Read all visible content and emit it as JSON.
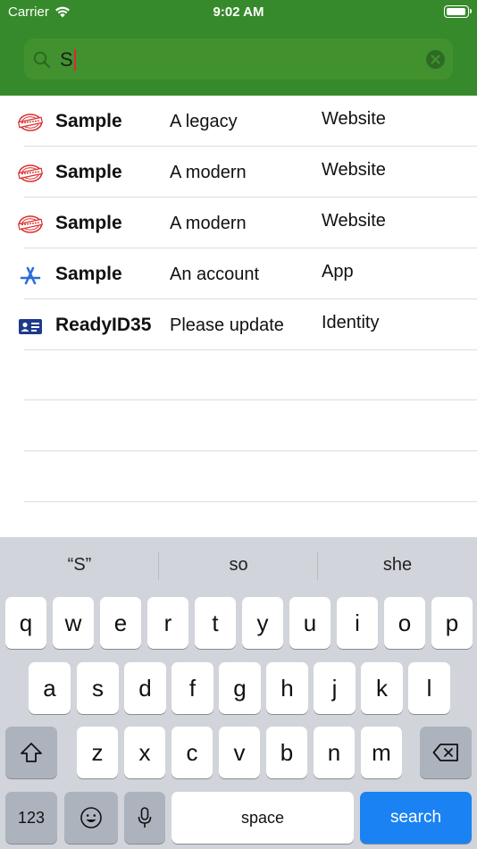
{
  "status_bar": {
    "carrier": "Carrier",
    "time": "9:02 AM"
  },
  "search": {
    "query": "S"
  },
  "results": [
    {
      "icon": "stamp-icon",
      "title": "Sample",
      "subtitle": "A legacy",
      "type": "Website"
    },
    {
      "icon": "stamp-icon",
      "title": "Sample",
      "subtitle": "A modern",
      "type": "Website"
    },
    {
      "icon": "stamp-icon",
      "title": "Sample",
      "subtitle": "A modern",
      "type": "Website"
    },
    {
      "icon": "app-store-icon",
      "title": "Sample",
      "subtitle": "An account",
      "type": "App"
    },
    {
      "icon": "id-card-icon",
      "title": "ReadyID35",
      "subtitle": "Please update",
      "type": "Identity"
    }
  ],
  "keyboard": {
    "suggestions": [
      "“S”",
      "so",
      "she"
    ],
    "row1": [
      "q",
      "w",
      "e",
      "r",
      "t",
      "y",
      "u",
      "i",
      "o",
      "p"
    ],
    "row2": [
      "a",
      "s",
      "d",
      "f",
      "g",
      "h",
      "j",
      "k",
      "l"
    ],
    "row3": [
      "z",
      "x",
      "c",
      "v",
      "b",
      "n",
      "m"
    ],
    "numbers_label": "123",
    "space_label": "space",
    "search_label": "search"
  },
  "colors": {
    "header_green": "#378a2b",
    "search_blue": "#1a82f3",
    "stamp_red": "#d9302e",
    "app_blue": "#2a6fdb",
    "id_navy": "#1f3a8a"
  }
}
